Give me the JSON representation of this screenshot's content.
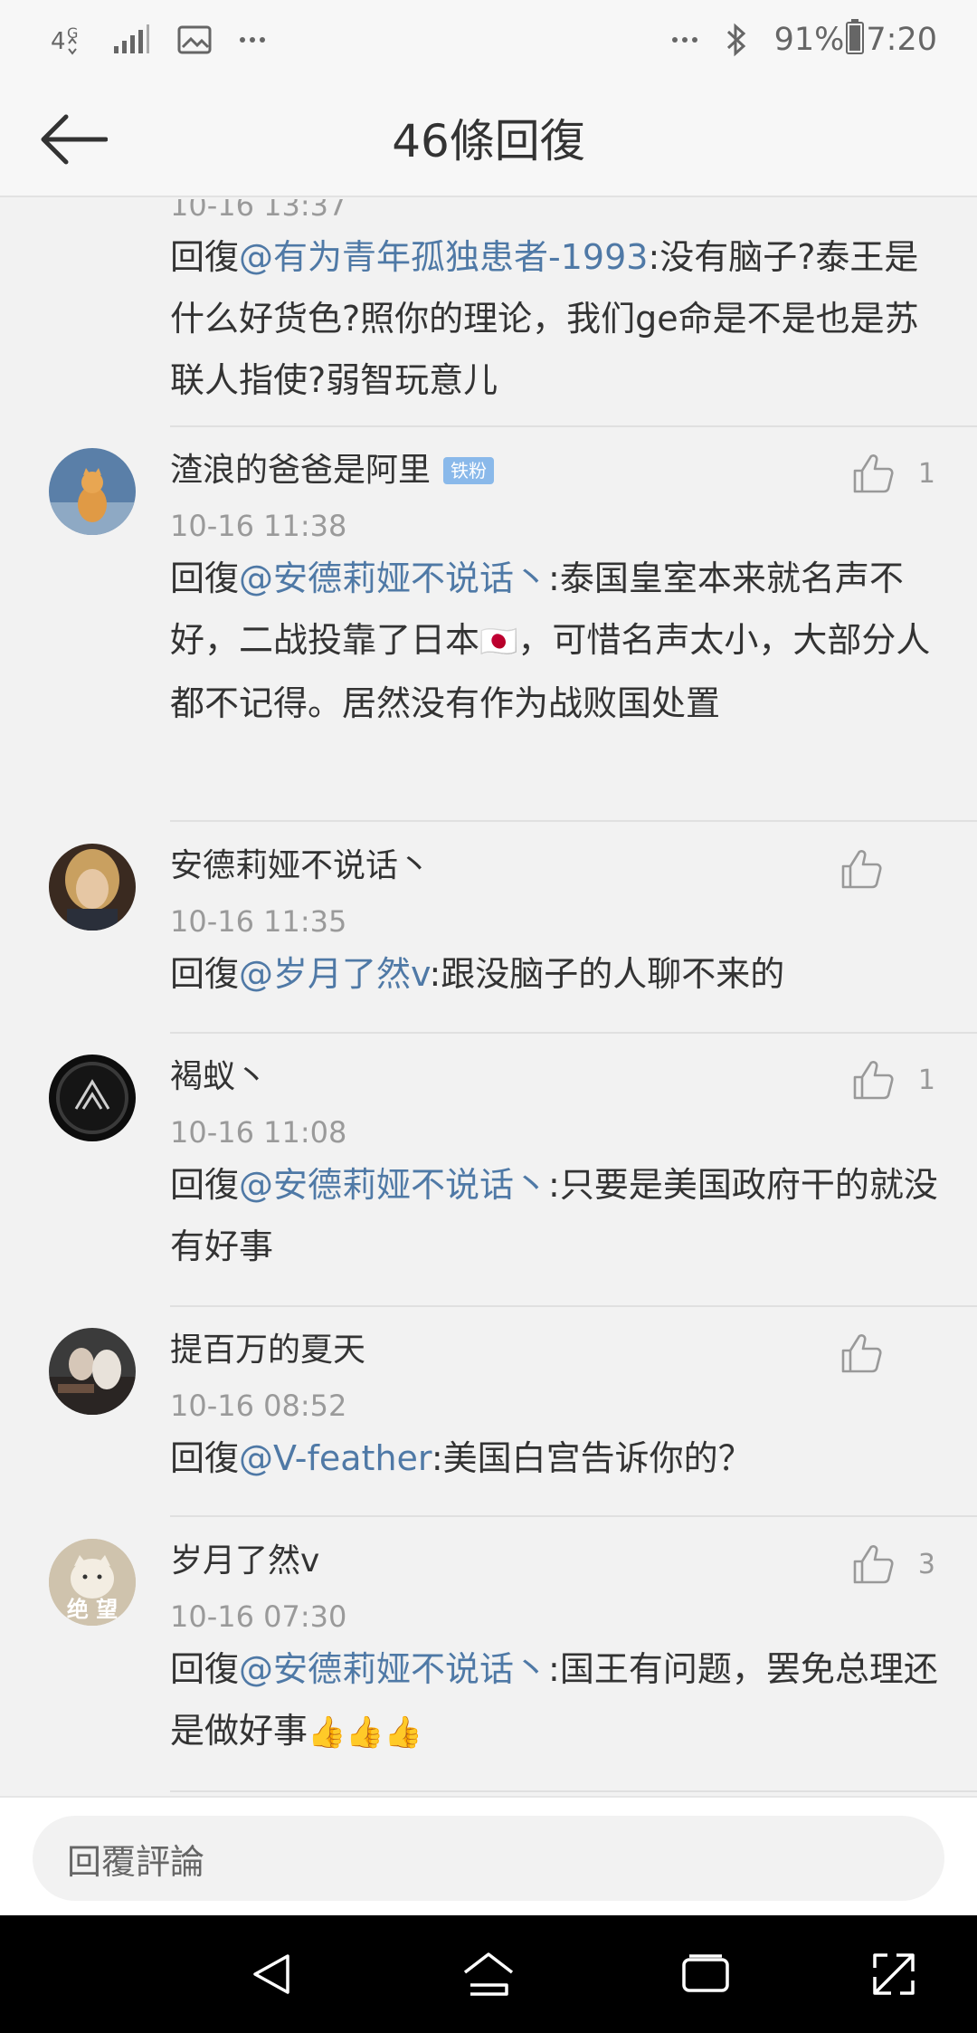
{
  "status_bar": {
    "network": "4G",
    "battery": "91%",
    "time": "7:20",
    "icons": [
      "network-4g-icon",
      "signal-icon",
      "gallery-icon",
      "more-dots-icon",
      "bluetooth-icon",
      "battery-icon"
    ]
  },
  "header": {
    "title": "46條回復"
  },
  "partial_comment": {
    "time": "10-16 13:37",
    "reply_prefix": "回復",
    "mention": "@有为青年孤独患者-1993",
    "text": ":没有脑子?泰王是什么好货色?照你的理论，我们ge命是不是也是苏联人指使?弱智玩意儿"
  },
  "comments": [
    {
      "username": "渣浪的爸爸是阿里",
      "badge": "铁粉",
      "time": "10-16 11:38",
      "likes": "1",
      "reply_prefix": "回復",
      "mention": "@安德莉娅不说话丶",
      "text_before": ":泰国皇室本来就名声不好，二战投靠了日本",
      "emoji": "🇯🇵",
      "text_after": "，可惜名声太小，大部分人都不记得。居然没有作为战败国处置"
    },
    {
      "username": "安德莉娅不说话丶",
      "time": "10-16 11:35",
      "likes": "",
      "reply_prefix": "回復",
      "mention": "@岁月了然v",
      "text": ":跟没脑子的人聊不来的"
    },
    {
      "username": "褐蚁丶",
      "time": "10-16 11:08",
      "likes": "1",
      "reply_prefix": "回復",
      "mention": "@安德莉娅不说话丶",
      "text": ":只要是美国政府干的就没有好事"
    },
    {
      "username": "提百万的夏天",
      "time": "10-16 08:52",
      "likes": "",
      "reply_prefix": "回復",
      "mention": "@V-feather",
      "text": ":美国白宫告诉你的？"
    },
    {
      "username": "岁月了然v",
      "avatar_text": "绝 望",
      "time": "10-16 07:30",
      "likes": "3",
      "reply_prefix": "回復",
      "mention": "@安德莉娅不说话丶",
      "text": ":国王有问题，罢免总理还是做好事",
      "emoji": "👍👍👍"
    }
  ],
  "reply_bar": {
    "placeholder": "回覆評論"
  },
  "nav": {
    "icons": [
      "back-triangle-icon",
      "home-icon",
      "recents-icon",
      "screenshot-expand-icon"
    ]
  },
  "colors": {
    "mention": "#4f79a6",
    "background": "#f2f2f2",
    "badge": "#8ab9ea"
  }
}
